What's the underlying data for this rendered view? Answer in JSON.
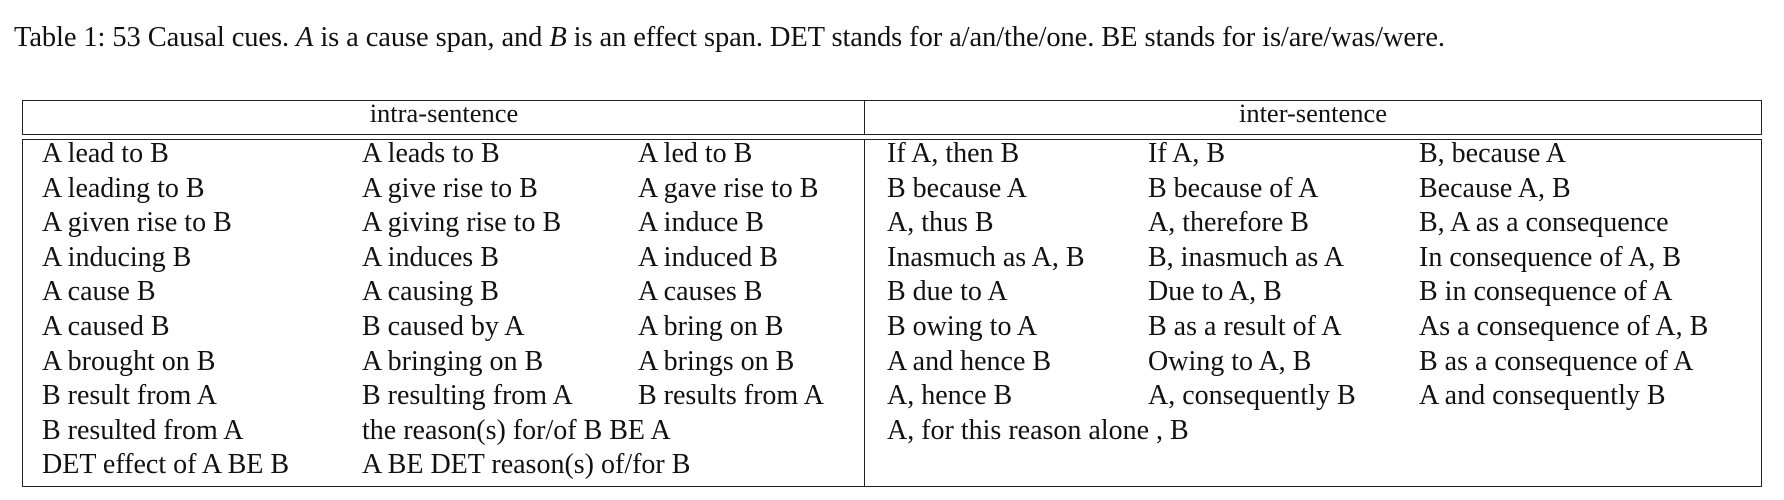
{
  "caption": {
    "prefix": "Table 1: 53 Causal cues. ",
    "a": "A",
    "mid1": " is a cause span, and ",
    "b": "B",
    "suffix": " is an effect span. DET stands for a/an/the/one. BE stands for is/are/was/were."
  },
  "table": {
    "headers": [
      "intra-sentence",
      "inter-sentence"
    ],
    "intra_rows": [
      [
        "A lead to B",
        "A leads to B",
        "A led to B"
      ],
      [
        "A leading to B",
        "A give rise to B",
        "A gave rise to B"
      ],
      [
        "A given rise to B",
        "A giving rise to B",
        "A induce B"
      ],
      [
        "A inducing B",
        "A induces B",
        "A induced B"
      ],
      [
        "A cause B",
        "A causing B",
        "A causes B"
      ],
      [
        "A caused B",
        "B caused by A",
        "A bring on B"
      ],
      [
        "A brought on B",
        "A bringing on B",
        "A brings on B"
      ],
      [
        "B result from A",
        "B resulting from A",
        "B results from A"
      ],
      [
        "B resulted from A",
        "the reason(s) for/of B BE A",
        ""
      ],
      [
        "DET effect of A BE B",
        "A BE DET reason(s) of/for B",
        ""
      ]
    ],
    "inter_rows": [
      [
        "If A, then B",
        "If A, B",
        "B, because A"
      ],
      [
        "B because A",
        "B because of A",
        "Because A, B"
      ],
      [
        "A, thus B",
        "A, therefore B",
        "B, A as a consequence"
      ],
      [
        "Inasmuch as A, B",
        "B, inasmuch as A",
        "In consequence of A, B"
      ],
      [
        "B due to A",
        "Due to A, B",
        "B in consequence of A"
      ],
      [
        "B owing to A",
        "B as a result of A",
        "As a consequence of A, B"
      ],
      [
        "A and hence B",
        "Owing to A, B",
        "B as a consequence of A"
      ],
      [
        "A, hence B",
        "A, consequently B",
        "A and consequently B"
      ],
      [
        "A, for this reason alone , B",
        "",
        ""
      ]
    ]
  }
}
